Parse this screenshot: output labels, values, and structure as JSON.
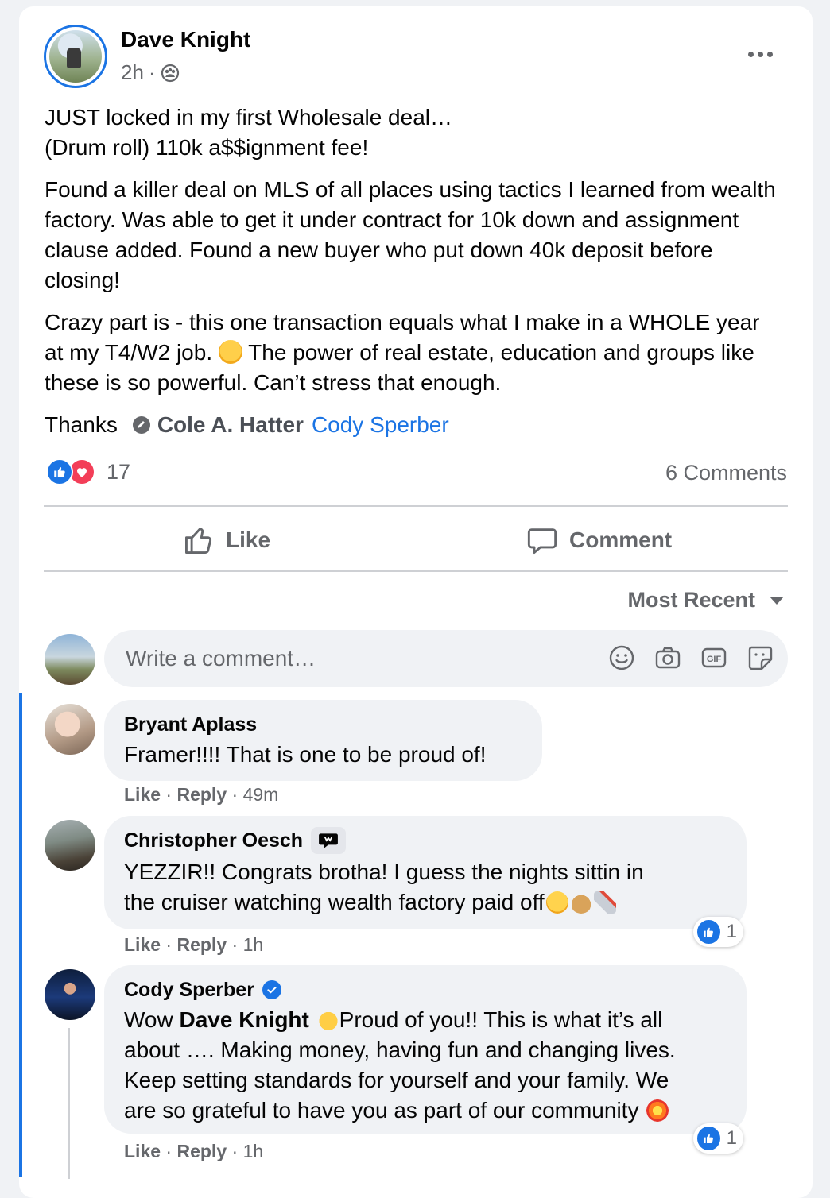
{
  "post": {
    "author": "Dave Knight",
    "time": "2h",
    "separator": "·",
    "paragraph1_line1": "JUST locked in my first Wholesale deal…",
    "paragraph1_line2": "(Drum roll) 110k a$$ignment fee!",
    "paragraph2": "Found a killer deal on MLS of all places using tactics I learned from wealth factory. Was able to get it under contract for 10k down and assignment clause added. Found a new buyer who put down 40k deposit before closing!",
    "paragraph3_a": "Crazy part is - this one transaction equals what I make in a WHOLE year at my T4/W2 job.",
    "paragraph3_b": "The power of real estate, education and groups like these is so powerful. Can’t stress that enough.",
    "thanks": "Thanks",
    "mention1": "Cole A. Hatter",
    "mention2": "Cody Sperber",
    "reaction_count": "17",
    "comments_count": "6 Comments"
  },
  "actions": {
    "like": "Like",
    "comment": "Comment"
  },
  "sort": {
    "label": "Most Recent"
  },
  "composer": {
    "placeholder": "Write a comment…"
  },
  "comments": [
    {
      "author": "Bryant Aplass",
      "text": "Framer!!!! That is one to be proud of!",
      "like": "Like",
      "reply": "Reply",
      "time": "49m"
    },
    {
      "author": "Christopher Oesch",
      "text_line1": "YEZZIR!! Congrats brotha! I guess the nights sittin in",
      "text_line2": "the cruiser watching wealth factory paid off",
      "like": "Like",
      "reply": "Reply",
      "time": "1h",
      "reaction_count": "1"
    },
    {
      "author": "Cody Sperber",
      "prefix": "Wow",
      "mention": "Dave Knight",
      "text_a": "Proud of you!! This is what it’s all",
      "text_b": "about …. Making money, having fun and changing lives.",
      "text_c": "Keep setting standards for yourself and your family. We",
      "text_d": "are so grateful to have you as part of our community",
      "like": "Like",
      "reply": "Reply",
      "time": "1h",
      "reaction_count": "1"
    }
  ],
  "colors": {
    "accent": "#1b74e4",
    "love": "#f33e58",
    "secondary_text": "#65676b",
    "bubble": "#f0f2f5"
  },
  "icons": [
    "group-icon",
    "more-icon",
    "like-reaction-icon",
    "love-reaction-icon",
    "thumbs-up-icon",
    "comment-icon",
    "caret-down-icon",
    "emoji-icon",
    "camera-icon",
    "gif-icon",
    "sticker-icon",
    "fan-badge-icon",
    "verified-icon",
    "mention-tag-icon"
  ]
}
